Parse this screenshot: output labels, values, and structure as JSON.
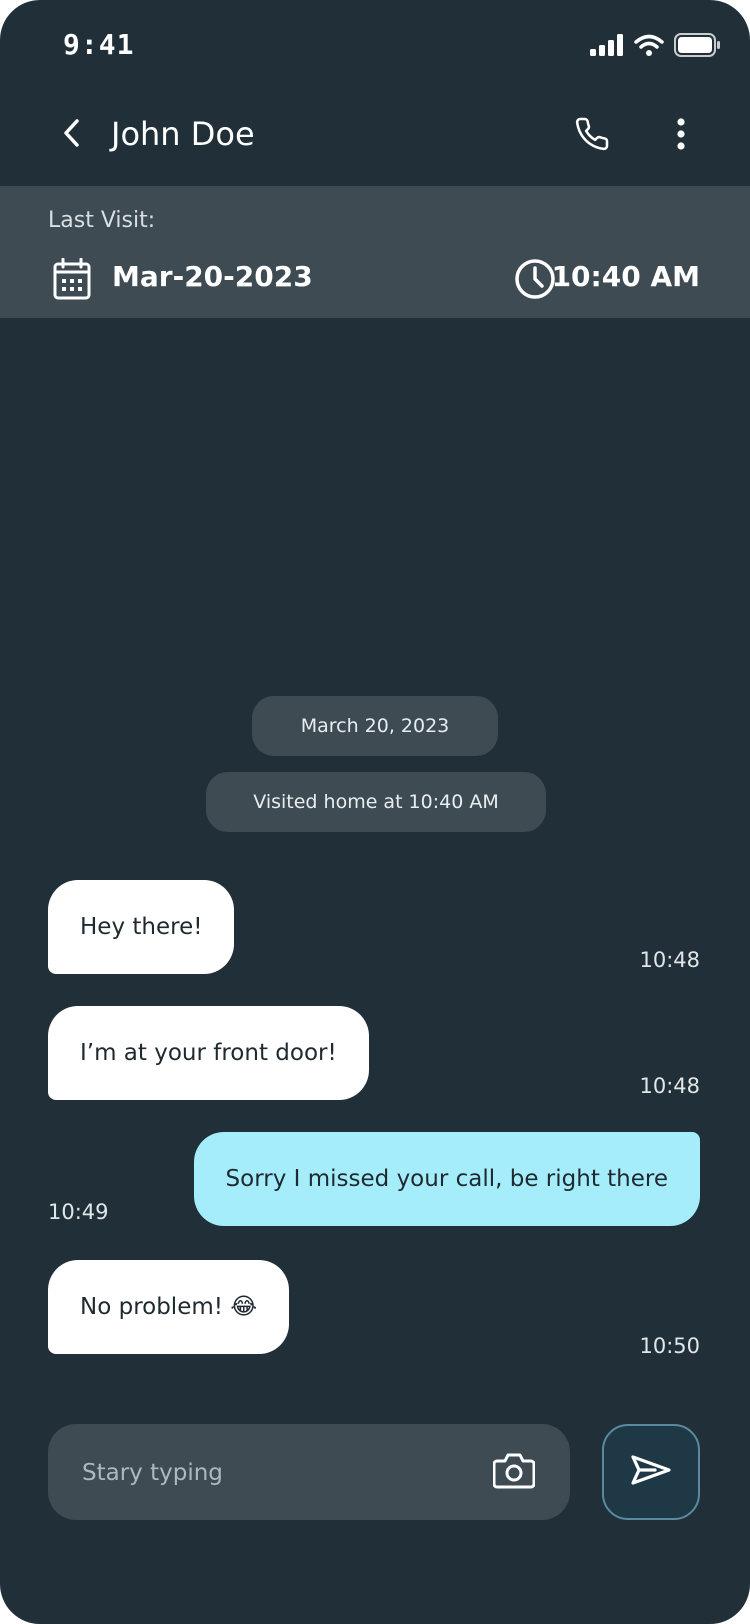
{
  "status_bar": {
    "time": "9:41"
  },
  "header": {
    "title": "John Doe"
  },
  "visit_banner": {
    "label": "Last Visit:",
    "date": "Mar-20-2023",
    "time": "10:40 AM"
  },
  "chat": {
    "date_divider": "March 20, 2023",
    "event": "Visited home at 10:40 AM",
    "messages": [
      {
        "direction": "incoming",
        "text": "Hey there!",
        "time": "10:48"
      },
      {
        "direction": "incoming",
        "text": "I’m at your front door!",
        "time": "10:48"
      },
      {
        "direction": "outgoing",
        "text": "Sorry I missed your call, be right there",
        "time": "10:49"
      },
      {
        "direction": "incoming",
        "text": "No problem! 😂",
        "time": "10:50"
      }
    ]
  },
  "composer": {
    "placeholder": "Stary typing",
    "value": ""
  },
  "icons": {
    "back": "chevron-left-icon",
    "call": "phone-icon",
    "more": "more-vertical-icon",
    "date": "calendar-icon",
    "time": "clock-icon",
    "camera": "camera-icon",
    "send": "send-icon"
  },
  "colors": {
    "background": "#213038",
    "banner": "#3e4b52",
    "incoming_bubble": "#ffffff",
    "outgoing_bubble": "#a6edfb",
    "send_border": "#5b8aa0"
  }
}
